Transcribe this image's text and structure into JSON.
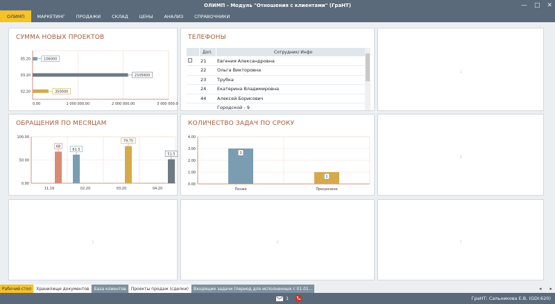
{
  "window": {
    "title": "ОЛИМП -  Модуль \"Отношения с клиентами\" (ГраНТ)",
    "minimize": "—",
    "maximize": "□",
    "close": "✕"
  },
  "menu": [
    "ОЛИМП",
    "МАРКЕТИНГ",
    "ПРОДАЖИ",
    "СКЛАД",
    "ЦЕНЫ",
    "АНАЛИЗ",
    "СПРАВОЧНИКИ"
  ],
  "panels": {
    "new_projects": {
      "title": "СУММА НОВЫХ ПРОЕКТОВ"
    },
    "phones": {
      "title": "ТЕЛЕФОНЫ"
    },
    "appeals": {
      "title": "ОБРАЩЕНИЯ ПО МЕСЯЦАМ"
    },
    "tasks": {
      "title": "КОЛИЧЕСТВО ЗАДАЧ ПО СРОКУ"
    },
    "empty": [
      "1",
      "4",
      "5",
      "6",
      "7"
    ]
  },
  "phones_table": {
    "headers": [
      "",
      "Доп.",
      "Сотрудник/ Инфо"
    ],
    "rows": [
      {
        "ext": "21",
        "name": "Евгения Александровна"
      },
      {
        "ext": "22",
        "name": "Ольга Викторовна"
      },
      {
        "ext": "23",
        "name": "Трубка"
      },
      {
        "ext": "24",
        "name": "Екатерина Владимировна"
      },
      {
        "ext": "44",
        "name": "Алексей Борисович"
      },
      {
        "ext": "",
        "name": "Городской - 9"
      }
    ]
  },
  "chart_data": [
    {
      "type": "bar",
      "orientation": "horizontal",
      "title": "СУММА НОВЫХ ПРОЕКТОВ",
      "categories": [
        "05.20",
        "03.20",
        "02.20"
      ],
      "values": [
        106000,
        2105600,
        350000
      ],
      "labels": [
        "106000",
        "2105600",
        "350000"
      ],
      "colors": [
        "#7b9db1",
        "#6f7a82",
        "#d4aa4a"
      ],
      "xlim": [
        0,
        3000000
      ],
      "xticks": [
        "0.00",
        "1 000 000.00",
        "2 000 000.00",
        "3 000 000.00"
      ]
    },
    {
      "type": "bar",
      "title": "ОБРАЩЕНИЯ ПО МЕСЯЦАМ",
      "categories": [
        "11.19",
        "02.20",
        "03.20",
        "04.20"
      ],
      "values": [
        68,
        61.5,
        79.75,
        51.5
      ],
      "labels": [
        "68",
        "61.5",
        "79.75",
        "51.5"
      ],
      "colors": [
        "#d98a72",
        "#7b9db1",
        "#d4aa4a",
        "#6f7a82"
      ],
      "ylim": [
        0,
        100
      ],
      "yticks": [
        "100.00",
        "50.00",
        "0.00"
      ]
    },
    {
      "type": "bar",
      "title": "КОЛИЧЕСТВО ЗАДАЧ ПО СРОКУ",
      "categories": [
        "Позже",
        "Просрочено"
      ],
      "values": [
        3,
        1
      ],
      "labels": [
        "3",
        "1"
      ],
      "colors": [
        "#7b9db1",
        "#d4aa4a"
      ],
      "ylim": [
        0,
        4
      ],
      "yticks": [
        "4.00",
        "3.00",
        "2.00",
        "1.00",
        "0.00"
      ]
    }
  ],
  "tabs": [
    "Рабочий стол",
    "Хранилище документов",
    "База клиентов",
    "Проекты продаж (сделки)",
    "Входящие задачи (период для исполненных с 01.01..."
  ],
  "tab_arrows": {
    "left": "◂",
    "right": "▸"
  },
  "status": {
    "mail_count": "1",
    "user": "ГраНТ: Сальникова Е.В. (GDI:620)"
  }
}
